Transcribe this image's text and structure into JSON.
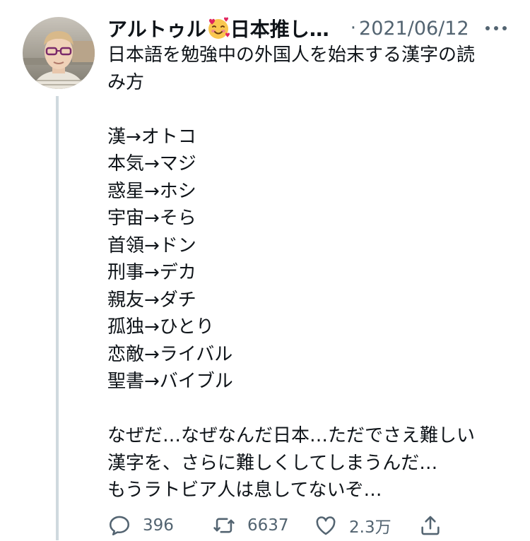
{
  "tweet": {
    "author_name": "アルトゥル",
    "author_suffix": "日本推し…",
    "date_separator": "·",
    "date": "2021/06/12",
    "text_lines": [
      "日本語を勉強中の外国人を始末する漢字の読",
      "み方",
      "",
      "漢→オトコ",
      "本気→マジ",
      "惑星→ホシ",
      "宇宙→そら",
      "首領→ドン",
      "刑事→デカ",
      "親友→ダチ",
      "孤独→ひとり",
      "恋敵→ライバル",
      "聖書→バイブル",
      "",
      "なぜだ…なぜなんだ日本…ただでさえ難しい",
      "漢字を、さらに難しくしてしまうんだ…",
      "もうラトビア人は息してないぞ…"
    ],
    "replies": "396",
    "retweets": "6637",
    "likes": "2.3万"
  },
  "icons": {
    "author_emoji": "smiling-face-with-hearts-icon",
    "more": "more-dots-icon",
    "reply": "reply-icon",
    "retweet": "retweet-icon",
    "like": "heart-icon",
    "share": "share-icon"
  },
  "colors": {
    "text": "#0f1419",
    "secondary": "#536471",
    "thread_line": "#cfd9de",
    "emoji": "#f9c74f"
  }
}
